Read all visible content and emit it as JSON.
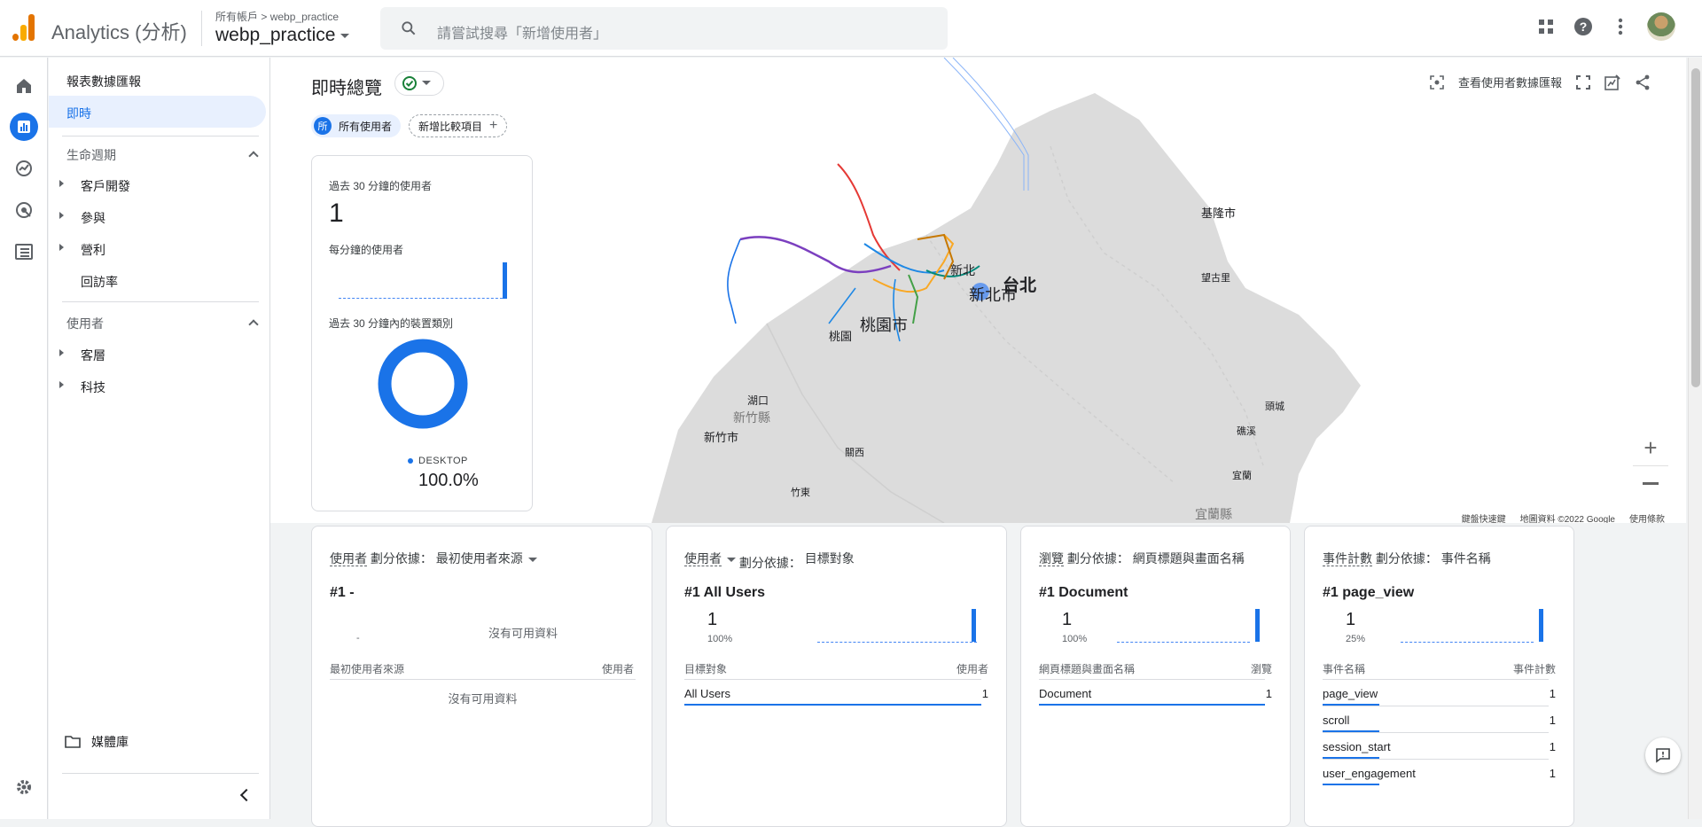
{
  "app": {
    "brand": "Analytics",
    "brand_suffix": "(分析)",
    "account_crumb_root": "所有帳戶",
    "account_crumb_sep": ">",
    "account_crumb_property": "webp_practice",
    "property_name": "webp_practice",
    "search_placeholder": "請嘗試搜尋「新增使用者」"
  },
  "nav": {
    "section_title": "報表數據匯報",
    "selected": "即時",
    "lifecycle_title": "生命週期",
    "lifecycle_items": [
      "客戶開發",
      "參與",
      "營利",
      "回訪率"
    ],
    "users_title": "使用者",
    "users_items": [
      "客層",
      "科技"
    ],
    "library": "媒體庫"
  },
  "page": {
    "title": "即時總覽",
    "chip_all_users_badge": "所",
    "chip_all_users": "所有使用者",
    "chip_add_compare": "新增比較項目",
    "view_user_snapshot": "查看使用者數據匯報"
  },
  "map": {
    "labels": {
      "keelung": "基隆市",
      "taipei": "台北",
      "new_taipei": "新北市",
      "xinbei_small": "新北",
      "taoyuan_city": "桃園市",
      "taoyuan": "桃園",
      "wanghsiang": "望古里",
      "hukou": "湖口",
      "hsinchu_county": "新竹縣",
      "hsinchu_city": "新竹市",
      "guanxi": "關西",
      "zhudong": "竹東",
      "toucheng": "頭城",
      "jiaoxi": "礁溪",
      "yilan": "宜蘭",
      "yilan_county": "宜蘭縣"
    },
    "footer": [
      "鍵盤快速鍵",
      "地圖資料 ©2022 Google",
      "使用條款"
    ]
  },
  "users_card": {
    "title": "過去 30 分鐘的使用者",
    "value": "1",
    "per_minute": "每分鐘的使用者",
    "device_title": "過去 30 分鐘內的裝置類別",
    "device_label": "DESKTOP",
    "device_pct": "100.0%"
  },
  "bottom_cards": [
    {
      "metric": "使用者",
      "dim_label": "劃分依據：",
      "dim": "最初使用者來源",
      "rank": "#1",
      "rank_name": "-",
      "dash": "-",
      "nodata": "沒有可用資料",
      "col_left": "最初使用者來源",
      "col_right": "使用者",
      "empty_text": "沒有可用資料"
    },
    {
      "metric": "使用者",
      "dim_label": "劃分依據：",
      "dim": "目標對象",
      "rank": "#1",
      "rank_name": "All Users",
      "value": "1",
      "pct": "100%",
      "col_left": "目標對象",
      "col_right": "使用者",
      "rows": [
        {
          "name": "All Users",
          "value": "1"
        }
      ]
    },
    {
      "metric": "瀏覽",
      "dim_label": "劃分依據：",
      "dim": "網頁標題與畫面名稱",
      "rank": "#1",
      "rank_name": "Document",
      "value": "1",
      "pct": "100%",
      "col_left": "網頁標題與畫面名稱",
      "col_right": "瀏覽",
      "rows": [
        {
          "name": "Document",
          "value": "1"
        }
      ]
    },
    {
      "metric": "事件計數",
      "dim_label": "劃分依據：",
      "dim": "事件名稱",
      "rank": "#1",
      "rank_name": "page_view",
      "value": "1",
      "pct": "25%",
      "col_left": "事件名稱",
      "col_right": "事件計數",
      "rows": [
        {
          "name": "page_view",
          "value": "1"
        },
        {
          "name": "scroll",
          "value": "1"
        },
        {
          "name": "session_start",
          "value": "1"
        },
        {
          "name": "user_engagement",
          "value": "1"
        }
      ]
    }
  ],
  "colors": {
    "accent": "#1a73e8",
    "logo_orange": "#f9ab00",
    "logo_dark_orange": "#e37400"
  }
}
